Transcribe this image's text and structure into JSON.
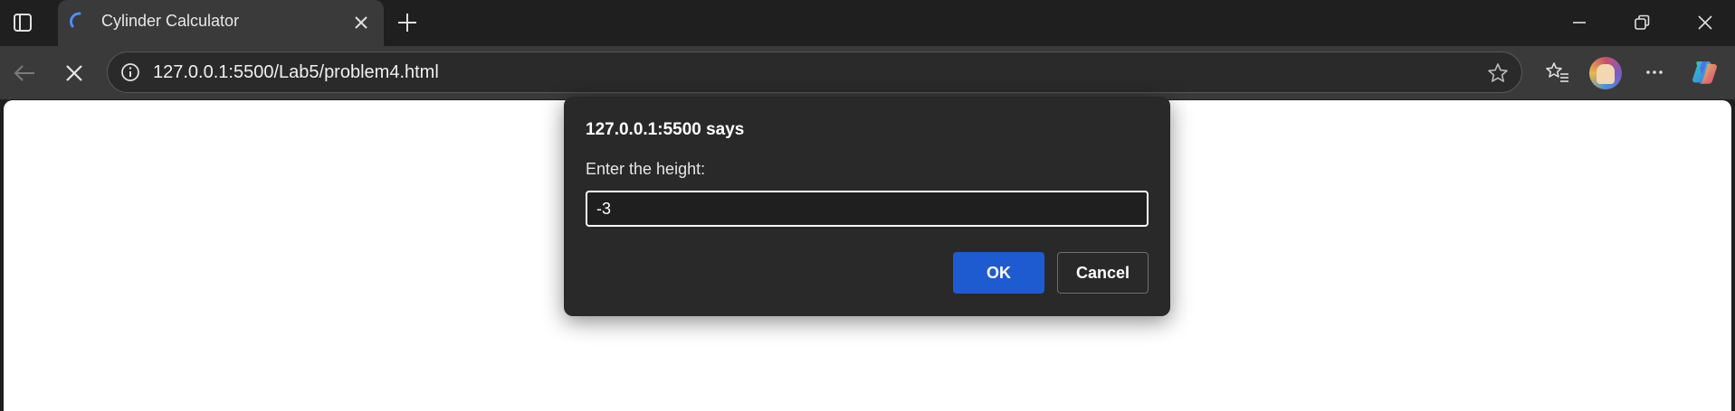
{
  "browser": {
    "tab": {
      "title": "Cylinder Calculator",
      "loading": true
    },
    "address_bar": {
      "url": "127.0.0.1:5500/Lab5/problem4.html"
    }
  },
  "dialog": {
    "title": "127.0.0.1:5500 says",
    "message": "Enter the height:",
    "input_value": "-3",
    "ok_label": "OK",
    "cancel_label": "Cancel"
  },
  "colors": {
    "accent": "#1f5bd0",
    "tab_spinner": "#4f8ef7"
  }
}
